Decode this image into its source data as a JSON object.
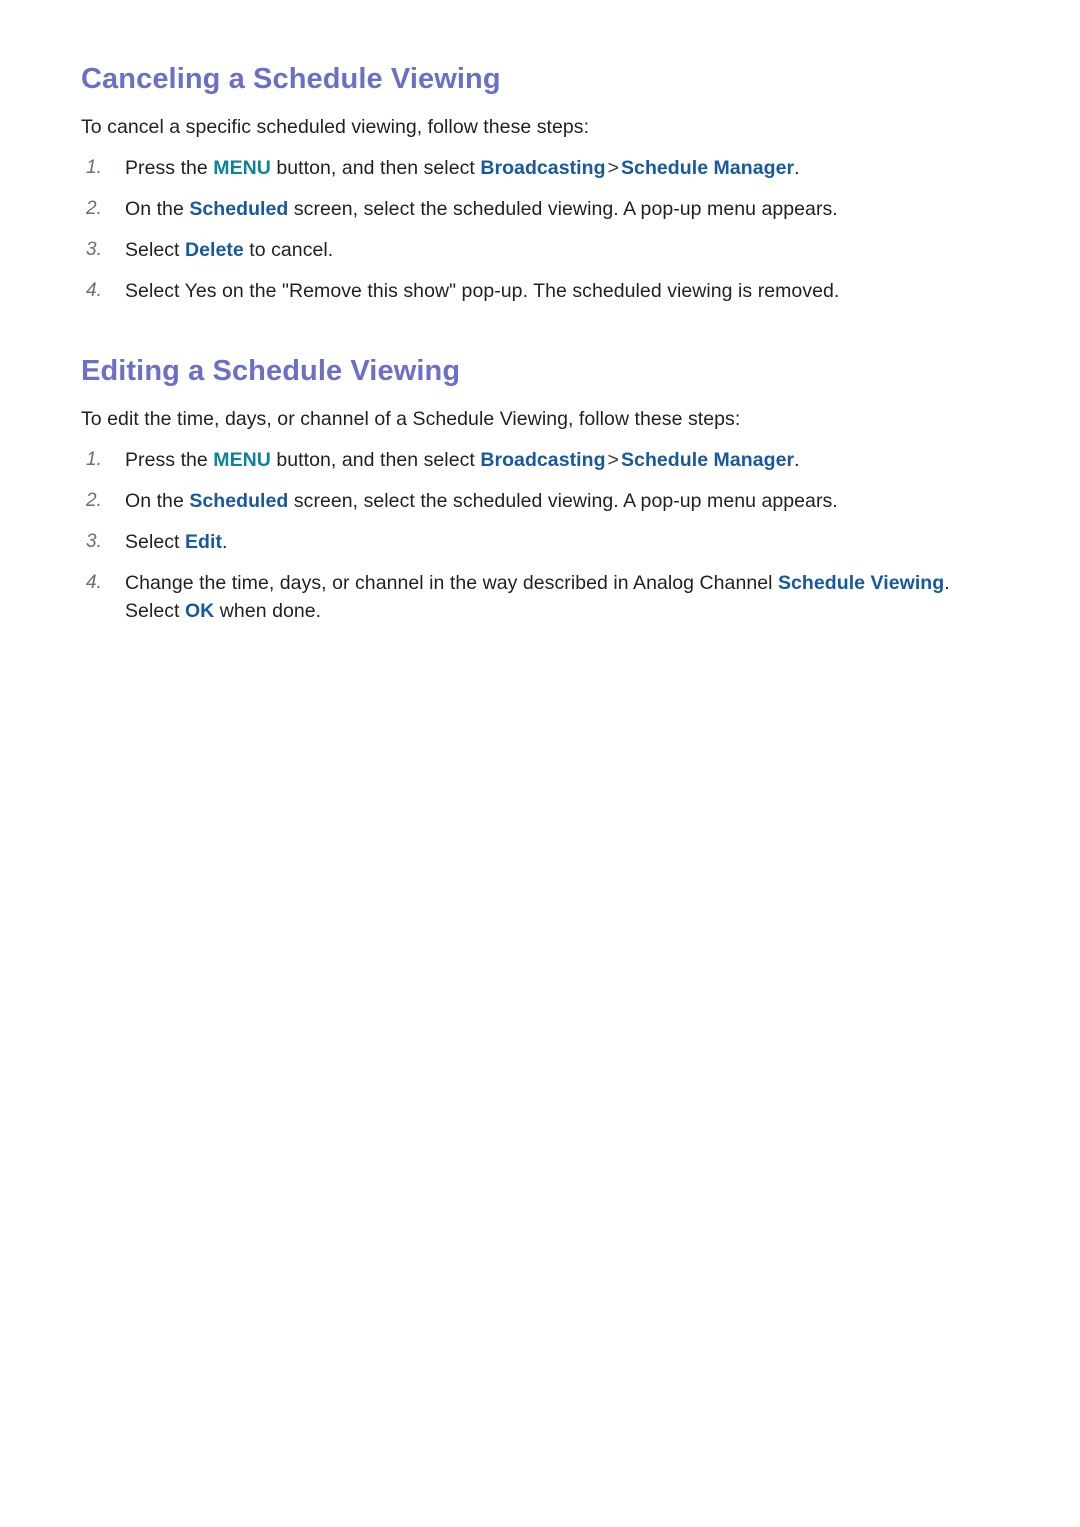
{
  "document": {
    "sections": [
      {
        "id": "canceling-a-schedule-viewing",
        "heading": "Canceling a Schedule Viewing",
        "intro": "To cancel a specific scheduled viewing, follow these steps:",
        "steps": [
          {
            "number": "1.",
            "parts": [
              {
                "text": "Press the ",
                "style": "normal"
              },
              {
                "text": "MENU",
                "style": "menu"
              },
              {
                "text": " button, and then select ",
                "style": "normal"
              },
              {
                "text": "Broadcasting",
                "style": "blue"
              },
              {
                "text": ">",
                "style": "separator"
              },
              {
                "text": "Schedule Manager",
                "style": "blue"
              },
              {
                "text": ".",
                "style": "normal"
              }
            ]
          },
          {
            "number": "2.",
            "parts": [
              {
                "text": "On the ",
                "style": "normal"
              },
              {
                "text": "Scheduled",
                "style": "blue"
              },
              {
                "text": " screen, select the scheduled viewing. A pop-up menu appears.",
                "style": "normal"
              }
            ]
          },
          {
            "number": "3.",
            "parts": [
              {
                "text": "Select ",
                "style": "normal"
              },
              {
                "text": "Delete",
                "style": "blue"
              },
              {
                "text": " to cancel.",
                "style": "normal"
              }
            ]
          },
          {
            "number": "4.",
            "parts": [
              {
                "text": "Select Yes on the \"Remove this show\" pop-up. The scheduled viewing is removed.",
                "style": "normal"
              }
            ]
          }
        ]
      },
      {
        "id": "editing-a-schedule-viewing",
        "heading": "Editing a Schedule Viewing",
        "intro": "To edit the time, days, or channel of a Schedule Viewing, follow these steps:",
        "steps": [
          {
            "number": "1.",
            "parts": [
              {
                "text": "Press the ",
                "style": "normal"
              },
              {
                "text": "MENU",
                "style": "menu"
              },
              {
                "text": " button, and then select ",
                "style": "normal"
              },
              {
                "text": "Broadcasting",
                "style": "blue"
              },
              {
                "text": ">",
                "style": "separator"
              },
              {
                "text": "Schedule Manager",
                "style": "blue"
              },
              {
                "text": ".",
                "style": "normal"
              }
            ]
          },
          {
            "number": "2.",
            "parts": [
              {
                "text": "On the ",
                "style": "normal"
              },
              {
                "text": "Scheduled",
                "style": "blue"
              },
              {
                "text": " screen, select the scheduled viewing. A pop-up menu appears.",
                "style": "normal"
              }
            ]
          },
          {
            "number": "3.",
            "parts": [
              {
                "text": "Select ",
                "style": "normal"
              },
              {
                "text": "Edit",
                "style": "blue"
              },
              {
                "text": ".",
                "style": "normal"
              }
            ]
          },
          {
            "number": "4.",
            "parts": [
              {
                "text": "Change the time, days, or channel in the way described in Analog Channel ",
                "style": "normal"
              },
              {
                "text": "Schedule Viewing",
                "style": "blue"
              },
              {
                "text": ". Select ",
                "style": "normal"
              },
              {
                "text": "OK",
                "style": "blue"
              },
              {
                "text": " when done.",
                "style": "normal"
              }
            ]
          }
        ]
      }
    ]
  },
  "colors": {
    "heading": "#6a6fc8",
    "keyword_menu": "#0e8298",
    "keyword_blue": "#17599f",
    "body_text": "#231f20",
    "list_number": "#6d6e71",
    "background": "#ffffff"
  }
}
